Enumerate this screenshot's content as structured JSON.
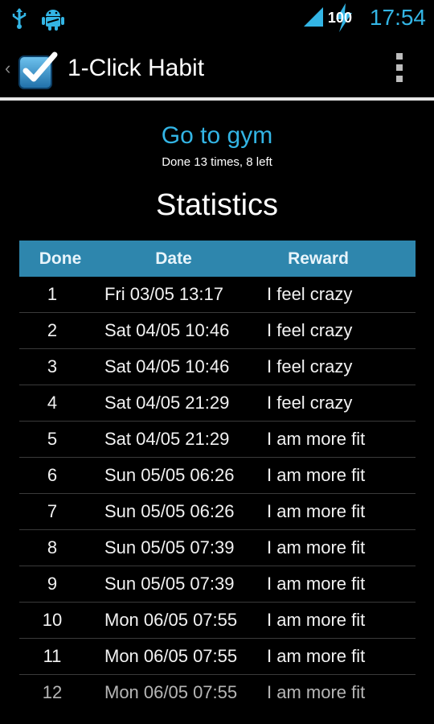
{
  "status_bar": {
    "icons_left": [
      "usb-icon",
      "android-debug-icon"
    ],
    "signal_icon": "signal-icon",
    "battery_icon": "battery-charging-icon",
    "battery_level": "100",
    "time": "17:54",
    "accent_color": "#33b5e5"
  },
  "action_bar": {
    "title": "1-Click Habit",
    "up_icon": "chevron-left-icon",
    "app_icon": "checkbox-icon",
    "menu_icon": "overflow-menu-icon"
  },
  "habit": {
    "name": "Go to gym",
    "summary": "Done 13 times, 8 left"
  },
  "statistics": {
    "title": "Statistics",
    "columns": [
      "Done",
      "Date",
      "Reward"
    ],
    "header_color": "#2e86ad",
    "rows": [
      {
        "done": "1",
        "date": "Fri 03/05 13:17",
        "reward": "I feel crazy"
      },
      {
        "done": "2",
        "date": "Sat 04/05 10:46",
        "reward": "I feel crazy"
      },
      {
        "done": "3",
        "date": "Sat 04/05 10:46",
        "reward": "I feel crazy"
      },
      {
        "done": "4",
        "date": "Sat 04/05 21:29",
        "reward": "I feel crazy"
      },
      {
        "done": "5",
        "date": "Sat 04/05 21:29",
        "reward": "I am more fit"
      },
      {
        "done": "6",
        "date": "Sun 05/05 06:26",
        "reward": "I am more fit"
      },
      {
        "done": "7",
        "date": "Sun 05/05 06:26",
        "reward": "I am more fit"
      },
      {
        "done": "8",
        "date": "Sun 05/05 07:39",
        "reward": "I am more fit"
      },
      {
        "done": "9",
        "date": "Sun 05/05 07:39",
        "reward": "I am more fit"
      },
      {
        "done": "10",
        "date": "Mon 06/05 07:55",
        "reward": "I am more fit"
      },
      {
        "done": "11",
        "date": "Mon 06/05 07:55",
        "reward": "I am more fit"
      },
      {
        "done": "12",
        "date": "Mon 06/05 07:55",
        "reward": "I am more fit"
      }
    ]
  }
}
